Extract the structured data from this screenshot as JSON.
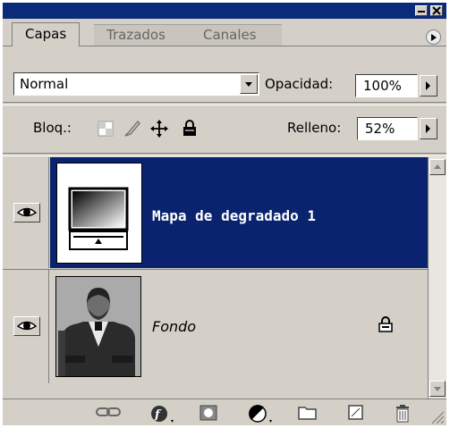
{
  "tabs": [
    {
      "label": "Capas",
      "active": true
    },
    {
      "label": "Trazados",
      "active": false
    },
    {
      "label": "Canales",
      "active": false
    }
  ],
  "blend_mode": {
    "value": "Normal"
  },
  "opacity": {
    "label": "Opacidad:",
    "value": "100%"
  },
  "lock": {
    "label": "Bloq.:"
  },
  "fill": {
    "label": "Relleno:",
    "value": "52%"
  },
  "layers": [
    {
      "name": "Mapa de degradado 1",
      "selected": true,
      "visible": true,
      "type": "gradient-map-adjustment",
      "locked": false
    },
    {
      "name": "Fondo",
      "selected": false,
      "visible": true,
      "type": "photo",
      "locked": true
    }
  ],
  "bottom_icons": [
    "link-layers-icon",
    "layer-style-icon",
    "add-mask-icon",
    "adjustment-layer-icon",
    "new-group-icon",
    "new-layer-icon",
    "trash-icon"
  ],
  "colors": {
    "selection": "#0a236e",
    "titlebar": "#0b2a7a",
    "panel": "#d4d0c8"
  }
}
